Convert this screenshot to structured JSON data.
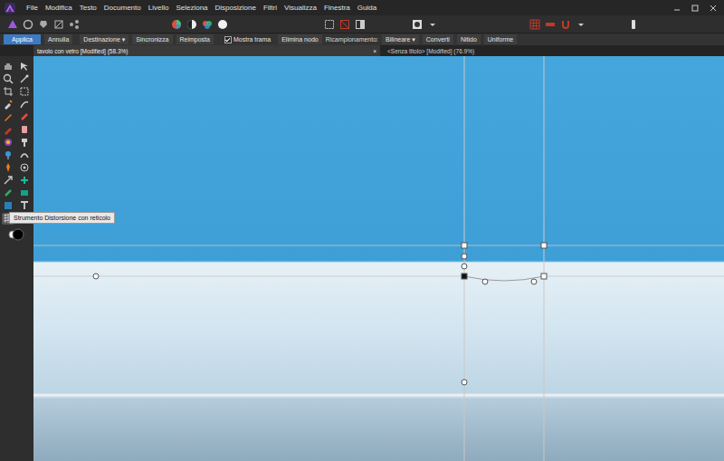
{
  "menu": [
    "File",
    "Modifica",
    "Testo",
    "Documento",
    "Livello",
    "Seleziona",
    "Disposizione",
    "Filtri",
    "Visualizza",
    "Finestra",
    "Guida"
  ],
  "context_toolbar": [
    {
      "kind": "primary",
      "label": "Applica"
    },
    {
      "kind": "button",
      "label": "Annulla"
    },
    {
      "kind": "dropdown",
      "label": "Destinazione",
      "arrow": "▾"
    },
    {
      "kind": "button",
      "label": "Sincronizza"
    },
    {
      "kind": "button",
      "label": "Reimposta"
    },
    {
      "kind": "checkbox",
      "label": "Mostra trama",
      "checked": true
    },
    {
      "kind": "button",
      "label": "Elimina nodo"
    },
    {
      "kind": "label",
      "label": "Ricampionamento:"
    },
    {
      "kind": "dropdown",
      "label": "Bilineare",
      "arrow": "▾"
    },
    {
      "kind": "button",
      "label": "Converti"
    },
    {
      "kind": "button",
      "label": "Nitido"
    },
    {
      "kind": "button",
      "label": "Uniforme"
    }
  ],
  "tabs": [
    {
      "label": "tavolo con vetro [Modified] (58.3%)",
      "selected": true,
      "close": "×"
    },
    {
      "label": "<Senza titolo> [Modified] (76.9%)",
      "selected": false
    }
  ],
  "tools": [
    {
      "selected": false
    },
    {
      "selected": false
    },
    {
      "selected": false
    },
    {
      "selected": false
    },
    {
      "selected": false
    },
    {
      "selected": false
    },
    {
      "selected": false
    },
    {
      "selected": false
    },
    {
      "selected": false
    },
    {
      "selected": false
    },
    {
      "selected": false
    },
    {
      "selected": false
    },
    {
      "selected": false
    },
    {
      "selected": false
    },
    {
      "selected": false
    },
    {
      "selected": false
    },
    {
      "selected": false
    },
    {
      "selected": false
    },
    {
      "selected": false
    },
    {
      "selected": false
    },
    {
      "selected": false
    },
    {
      "selected": false
    },
    {
      "selected": false
    },
    {
      "selected": false
    },
    {
      "selected": true
    }
  ],
  "tooltip": {
    "text": "Strumento Distorsione con reticolo"
  }
}
